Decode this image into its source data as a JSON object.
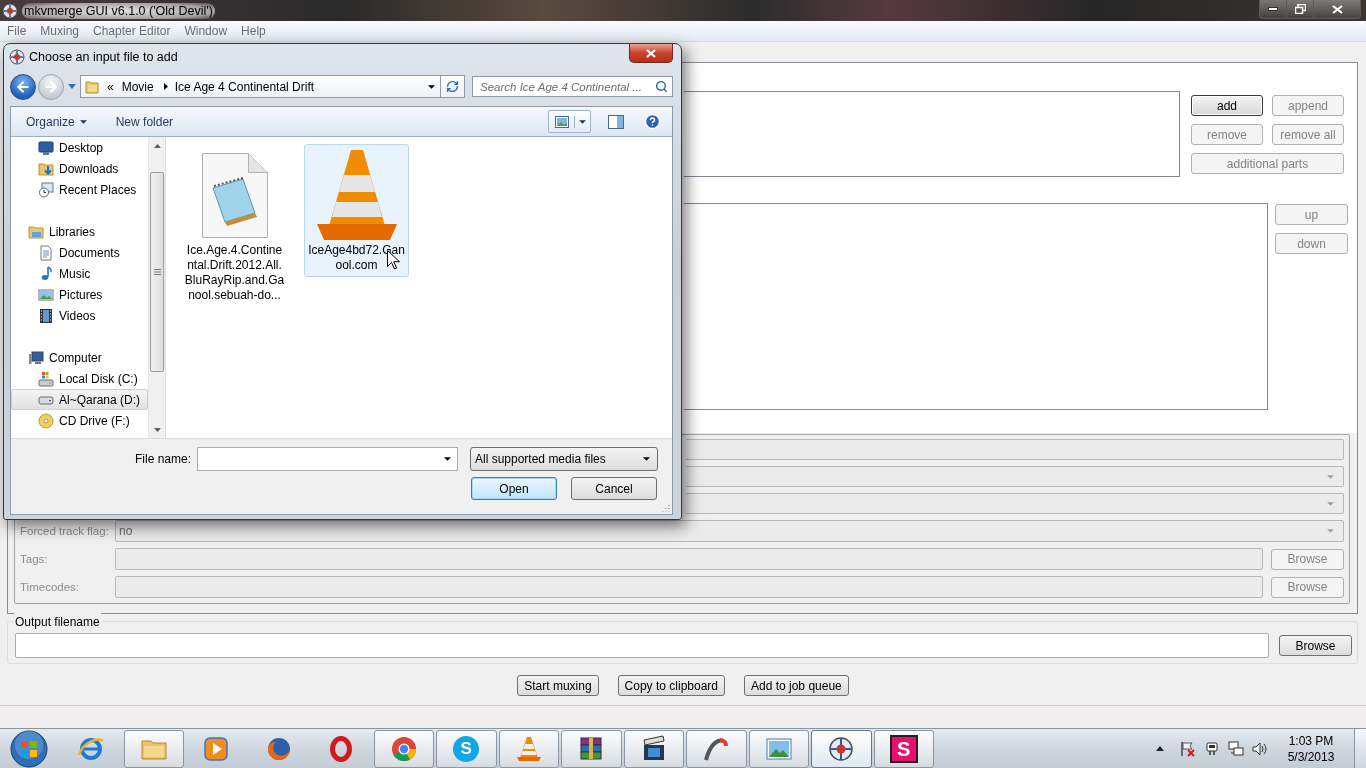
{
  "window": {
    "title": "mkvmerge GUI v6.1.0 ('Old Devil')"
  },
  "menu": [
    "File",
    "Muxing",
    "Chapter Editor",
    "Window",
    "Help"
  ],
  "input_files": {
    "buttons": [
      {
        "label": "add",
        "disabled": false,
        "focused": true
      },
      {
        "label": "append",
        "disabled": true,
        "focused": false
      },
      {
        "label": "remove",
        "disabled": true,
        "focused": false
      },
      {
        "label": "remove all",
        "disabled": true,
        "focused": false
      },
      {
        "label": "additional parts",
        "disabled": true,
        "focused": false
      }
    ]
  },
  "tracks": {
    "buttons": [
      {
        "label": "up",
        "disabled": true
      },
      {
        "label": "down",
        "disabled": true
      }
    ]
  },
  "track_options": {
    "rows": [
      {
        "kind": "text",
        "disabled": true
      },
      {
        "kind": "combo",
        "disabled": true
      },
      {
        "kind": "combo",
        "disabled": true
      },
      {
        "kind": "combo",
        "label": "Forced track flag:",
        "value": "no",
        "disabled": true
      },
      {
        "kind": "file",
        "label": "Tags:",
        "button": "Browse",
        "disabled": true
      },
      {
        "kind": "file",
        "label": "Timecodes:",
        "button": "Browse",
        "disabled": true
      }
    ]
  },
  "output": {
    "title": "Output filename",
    "button": "Browse"
  },
  "actions": [
    "Start muxing",
    "Copy to clipboard",
    "Add to job queue"
  ],
  "dialog": {
    "title": "Choose an input file to add",
    "address": {
      "overflow": "«",
      "path": [
        "Movie",
        "Ice Age 4 Continental Drift"
      ]
    },
    "search": {
      "placeholder": "Search Ice Age 4 Continental ..."
    },
    "toolbar": [
      {
        "label": "Organize",
        "menu": true
      },
      {
        "label": "New folder",
        "menu": false
      }
    ],
    "nav": [
      {
        "children": [
          {
            "label": "Desktop",
            "kind": "desktop",
            "selected": false
          },
          {
            "label": "Downloads",
            "kind": "downloads",
            "selected": false
          },
          {
            "label": "Recent Places",
            "kind": "recent",
            "selected": false
          }
        ]
      },
      {
        "label": "Libraries",
        "kind": "libraries",
        "selected": false,
        "children": [
          {
            "label": "Documents",
            "kind": "documents",
            "selected": false
          },
          {
            "label": "Music",
            "kind": "music",
            "selected": false
          },
          {
            "label": "Pictures",
            "kind": "pictures",
            "selected": false
          },
          {
            "label": "Videos",
            "kind": "videos",
            "selected": false
          }
        ]
      },
      {
        "label": "Computer",
        "kind": "computer",
        "selected": false,
        "children": [
          {
            "label": "Local Disk (C:)",
            "kind": "system-disk",
            "selected": false
          },
          {
            "label": "Al~Qarana (D:)",
            "kind": "disk",
            "selected": true
          },
          {
            "label": "CD Drive (F:)",
            "kind": "cd",
            "selected": false
          }
        ]
      }
    ],
    "files": [
      {
        "name": "Ice.Age.4.Continental.Drift.2012.All.BluRayRip.and.Ganool.sebuah-do...",
        "kind": "text-document",
        "hovered": false
      },
      {
        "name": "IceAge4bd72.Ganool.com",
        "kind": "media",
        "hovered": true
      }
    ],
    "file_name": {
      "label": "File name:"
    },
    "filter": "All supported media files",
    "buttons": [
      {
        "label": "Open",
        "default": true
      },
      {
        "label": "Cancel",
        "default": false
      }
    ]
  },
  "taskbar": {
    "apps": [
      {
        "kind": "browser-ring",
        "running": false,
        "active": false
      },
      {
        "kind": "folders",
        "running": true,
        "active": false
      },
      {
        "kind": "play",
        "running": false,
        "active": false
      },
      {
        "kind": "globe",
        "running": false,
        "active": false
      },
      {
        "kind": "ring",
        "running": false,
        "active": false
      },
      {
        "kind": "segmented",
        "running": true,
        "active": false
      },
      {
        "kind": "letter-circle",
        "glyph": "S",
        "running": true,
        "active": false
      },
      {
        "kind": "cone",
        "running": true,
        "active": false
      },
      {
        "kind": "books",
        "running": true,
        "active": false
      },
      {
        "kind": "clapper",
        "running": true,
        "active": false
      },
      {
        "kind": "swoosh",
        "running": true,
        "active": false
      },
      {
        "kind": "photo",
        "running": true,
        "active": false
      },
      {
        "kind": "disc-logo",
        "running": true,
        "active": true
      },
      {
        "kind": "letter-tile",
        "glyph": "S",
        "running": true,
        "active": false
      }
    ],
    "clock": {
      "time": "1:03 PM",
      "date": "5/3/2013"
    }
  }
}
